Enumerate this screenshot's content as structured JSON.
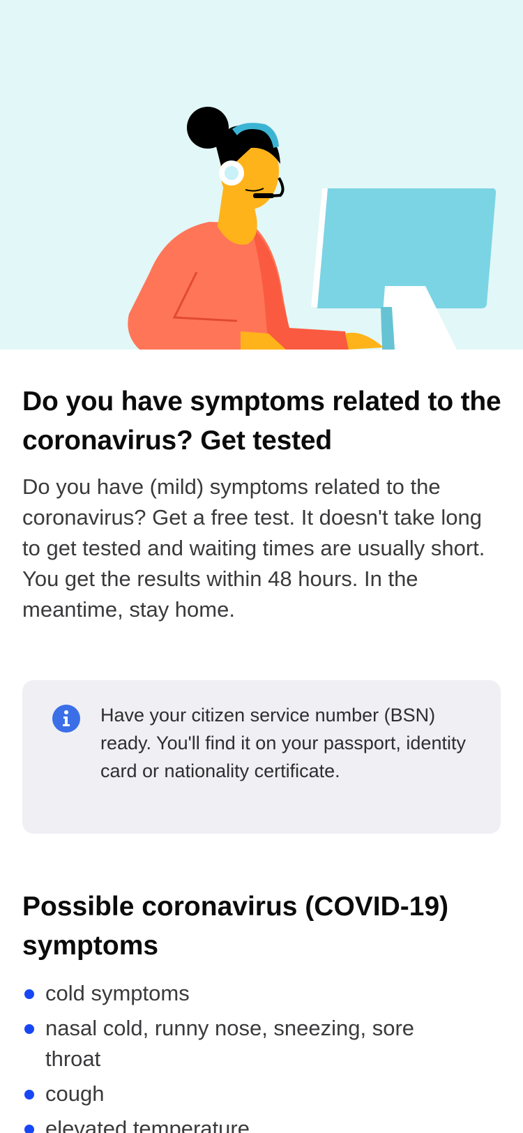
{
  "hero": {
    "illustration": "support-agent-with-headset-at-computer",
    "colors": {
      "background": "#e2f7f7",
      "monitor": "#7bd4e4",
      "sweater": "#ff7558",
      "skin": "#ffb31a",
      "hair": "#000000",
      "headset": "#3bb4d4"
    }
  },
  "main": {
    "title": "Do you have symptoms related to the coronavirus? Get tested",
    "intro": "Do you have (mild) symptoms related to the coronavirus? Get a free test. It doesn't take long to get tested and waiting times are usually short. You get the results within 48 hours. In the meantime, stay home."
  },
  "info": {
    "icon": "info-icon",
    "text": "Have your citizen service number (BSN) ready. You'll find it on your passport, identity card or nationality certificate.",
    "accent": "#3b6fe8"
  },
  "symptoms": {
    "title": "Possible coronavirus (COVID-19) symptoms",
    "bullet_color": "#1747f5",
    "items": [
      "cold symptoms",
      "nasal cold, runny nose, sneezing, sore throat",
      "cough",
      "elevated temperature"
    ]
  }
}
